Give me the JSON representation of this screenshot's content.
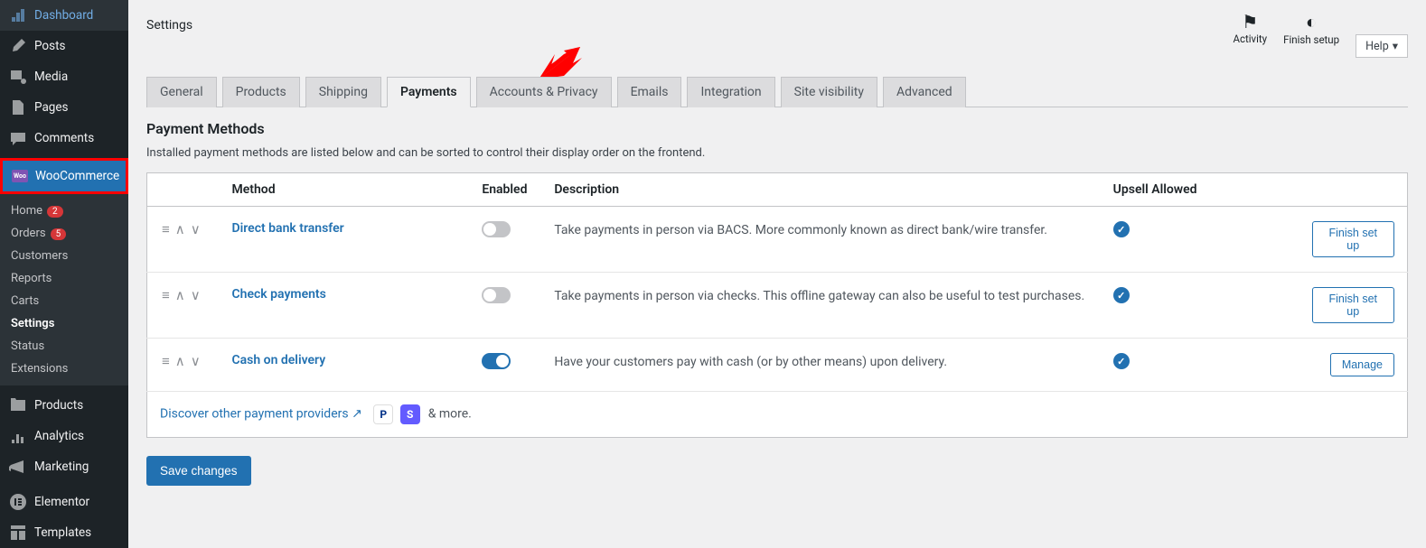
{
  "sidebar": {
    "top": [
      {
        "name": "dashboard",
        "label": "Dashboard"
      },
      {
        "name": "posts",
        "label": "Posts"
      },
      {
        "name": "media",
        "label": "Media"
      },
      {
        "name": "pages",
        "label": "Pages"
      },
      {
        "name": "comments",
        "label": "Comments"
      }
    ],
    "woocommerce_label": "WooCommerce",
    "submenu": [
      {
        "name": "home",
        "label": "Home",
        "badge": "2"
      },
      {
        "name": "orders",
        "label": "Orders",
        "badge": "5"
      },
      {
        "name": "customers",
        "label": "Customers"
      },
      {
        "name": "reports",
        "label": "Reports"
      },
      {
        "name": "carts",
        "label": "Carts"
      },
      {
        "name": "settings",
        "label": "Settings",
        "selected": true
      },
      {
        "name": "status",
        "label": "Status"
      },
      {
        "name": "extensions",
        "label": "Extensions"
      }
    ],
    "bottom": [
      {
        "name": "products",
        "label": "Products"
      },
      {
        "name": "analytics",
        "label": "Analytics"
      },
      {
        "name": "marketing",
        "label": "Marketing"
      }
    ],
    "bottom2": [
      {
        "name": "elementor",
        "label": "Elementor"
      },
      {
        "name": "templates",
        "label": "Templates"
      }
    ]
  },
  "header": {
    "page_title": "Settings",
    "activity_label": "Activity",
    "finish_label": "Finish setup",
    "help_label": "Help"
  },
  "tabs": [
    "General",
    "Products",
    "Shipping",
    "Payments",
    "Accounts & Privacy",
    "Emails",
    "Integration",
    "Site visibility",
    "Advanced"
  ],
  "active_tab": "Payments",
  "section": {
    "title": "Payment Methods",
    "desc": "Installed payment methods are listed below and can be sorted to control their display order on the frontend."
  },
  "columns": {
    "method": "Method",
    "enabled": "Enabled",
    "description": "Description",
    "upsell": "Upsell Allowed"
  },
  "methods": [
    {
      "name": "Direct bank transfer",
      "enabled": false,
      "desc": "Take payments in person via BACS. More commonly known as direct bank/wire transfer.",
      "upsell": true,
      "action": "Finish set up"
    },
    {
      "name": "Check payments",
      "enabled": false,
      "desc": "Take payments in person via checks. This offline gateway can also be useful to test purchases.",
      "upsell": true,
      "action": "Finish set up"
    },
    {
      "name": "Cash on delivery",
      "enabled": true,
      "desc": "Have your customers pay with cash (or by other means) upon delivery.",
      "upsell": true,
      "action": "Manage"
    }
  ],
  "discover": {
    "link": "Discover other payment providers",
    "more": "& more."
  },
  "save_label": "Save changes"
}
